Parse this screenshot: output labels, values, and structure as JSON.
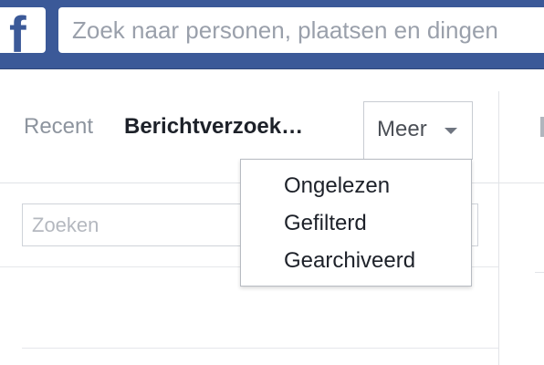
{
  "header": {
    "logo_letter": "f",
    "search_placeholder": "Zoek naar personen, plaatsen en dingen"
  },
  "messages": {
    "tabs": [
      {
        "label": "Recent"
      },
      {
        "label": "Berichtverzoek…"
      }
    ],
    "more_button": {
      "label": "Meer"
    },
    "search_placeholder": "Zoeken"
  },
  "more_menu": {
    "items": [
      {
        "label": "Ongelezen"
      },
      {
        "label": "Gefilterd"
      },
      {
        "label": "Gearchiveerd"
      }
    ]
  }
}
